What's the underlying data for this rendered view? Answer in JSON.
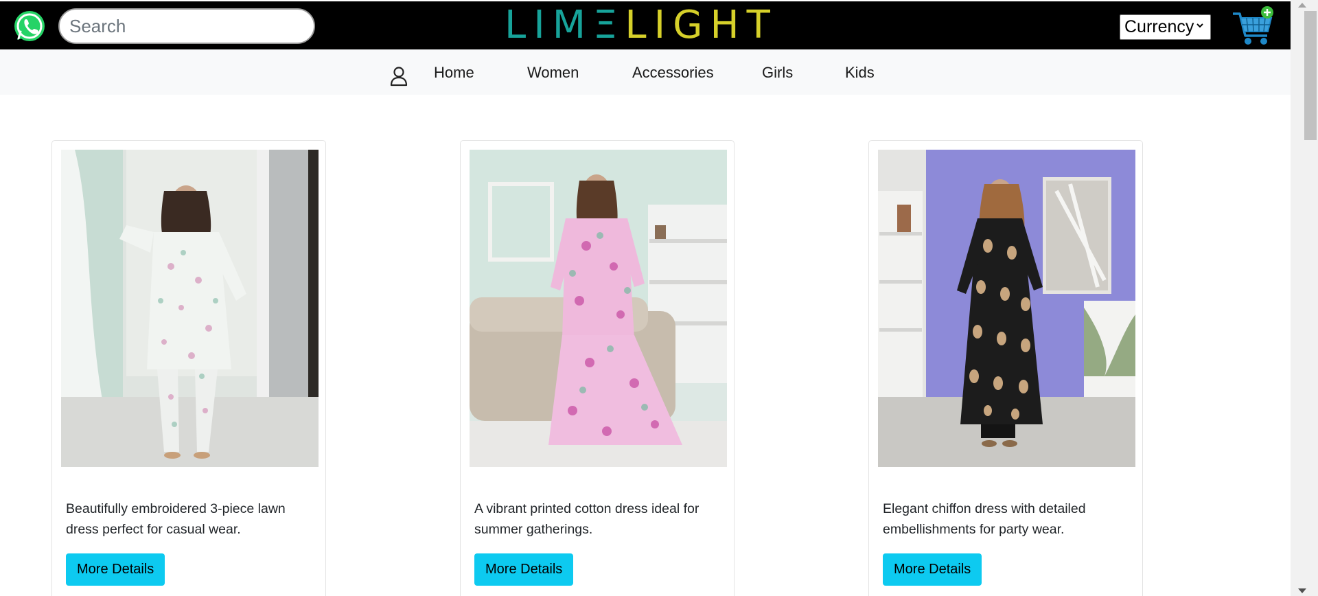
{
  "header": {
    "logo_part1": "LIMΞ",
    "logo_part2": "LIGHT",
    "search_placeholder": "Search",
    "currency_label": "Currency",
    "icons": [
      "whatsapp-icon",
      "shopping-cart-icon"
    ],
    "colors": {
      "bar": "#000000",
      "logo_teal": "#17a39a",
      "logo_yellow": "#d6d02a"
    }
  },
  "nav": {
    "items": [
      {
        "label": "Home"
      },
      {
        "label": "Women"
      },
      {
        "label": "Accessories"
      },
      {
        "label": "Girls"
      },
      {
        "label": "Kids"
      }
    ],
    "icons": [
      "user-icon"
    ]
  },
  "products": [
    {
      "description": "Beautifully embroidered 3-piece lawn dress perfect for casual wear.",
      "button": "More Details"
    },
    {
      "description": "A vibrant printed cotton dress ideal for summer gatherings.",
      "button": "More Details"
    },
    {
      "description": "Elegant chiffon dress with detailed embellishments for party wear.",
      "button": "More Details"
    }
  ],
  "colors": {
    "button": "#0dcaf0",
    "navbar": "#f8f9fa"
  }
}
